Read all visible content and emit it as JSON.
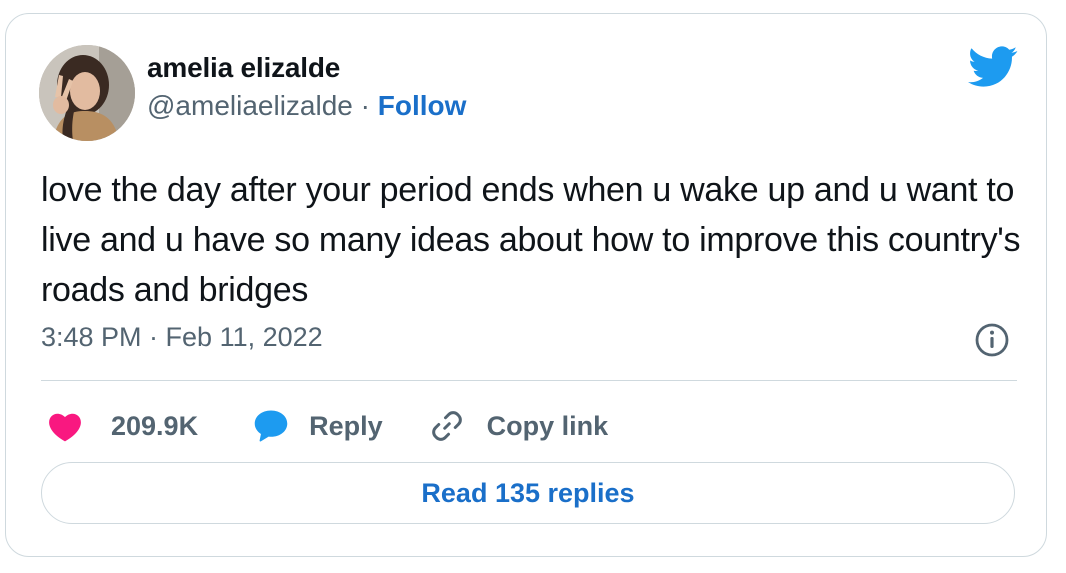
{
  "author": {
    "name": "amelia elizalde",
    "handle": "@ameliaelizalde",
    "separator": "·",
    "follow_label": "Follow"
  },
  "tweet": {
    "text": "love the day after your period ends when u wake up and u want to live and u have so many ideas about how to improve this country's roads and bridges",
    "timestamp": "3:48 PM · Feb 11, 2022"
  },
  "actions": {
    "like_count": "209.9K",
    "reply_label": "Reply",
    "copy_link_label": "Copy link"
  },
  "read_replies_label": "Read 135 replies",
  "icons": {
    "brand": "twitter-bird-icon",
    "info": "info-icon",
    "like": "heart-icon",
    "reply": "speech-bubble-icon",
    "copy": "link-icon"
  },
  "colors": {
    "brand_blue": "#1d9bf0",
    "link_blue": "#1a6fc9",
    "like_pink": "#f91880",
    "text": "#0f1419",
    "muted": "#536471",
    "border": "#cfd9de"
  }
}
